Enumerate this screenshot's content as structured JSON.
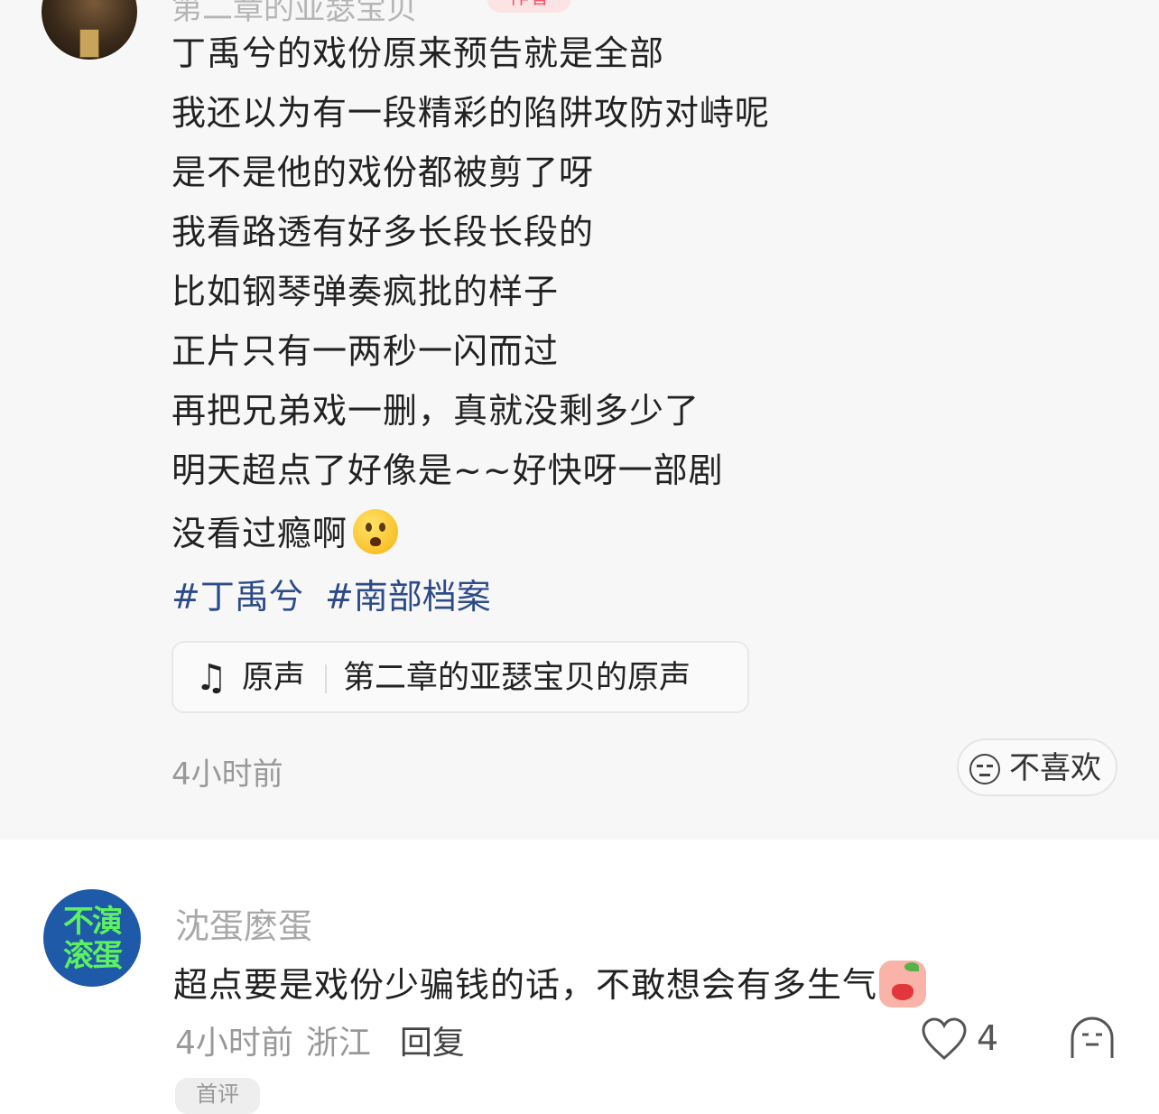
{
  "post": {
    "author_name": "第二章的亚瑟宝贝",
    "author_badge": "作者",
    "lines": [
      "丁禹兮的戏份原来预告就是全部",
      "我还以为有一段精彩的陷阱攻防对峙呢",
      "是不是他的戏份都被剪了呀",
      "我看路透有好多长段长段的",
      "比如钢琴弹奏疯批的样子",
      "正片只有一两秒一闪而过",
      "再把兄弟戏一删，真就没剩多少了",
      "明天超点了好像是~~好快呀一部剧",
      "没看过瘾啊"
    ],
    "tags": [
      "#丁禹兮",
      "#南部档案"
    ],
    "music": {
      "icon": "music-note-icon",
      "label": "原声",
      "title": "第二章的亚瑟宝贝的原声"
    },
    "time": "4小时前",
    "dislike_label": "不喜欢"
  },
  "comment": {
    "avatar_text_line1": "不演",
    "avatar_text_line2": "滚蛋",
    "username": "沈蛋麼蛋",
    "text": "超点要是戏份少骗钱的话，不敢想会有多生气",
    "time": "4小时前",
    "location": "浙江",
    "reply_label": "回复",
    "like_count": "4",
    "next_badge": "首评"
  }
}
